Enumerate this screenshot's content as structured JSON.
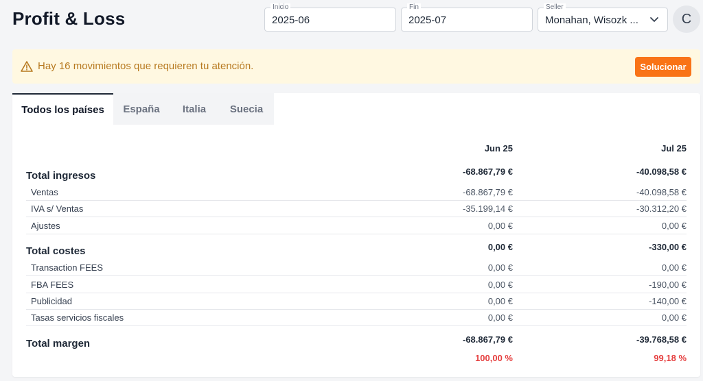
{
  "header": {
    "title": "Profit & Loss",
    "inicio": {
      "label": "Inicio",
      "value": "2025-06"
    },
    "fin": {
      "label": "Fin",
      "value": "2025-07"
    },
    "seller": {
      "label": "Seller",
      "value": "Monahan, Wisozk ..."
    },
    "avatar_initial": "C"
  },
  "alert": {
    "text": "Hay 16 movimientos que requieren tu atención.",
    "button": "Solucionar",
    "colors": {
      "background": "#fff8e1",
      "text": "#b7791f",
      "button": "#f97316"
    }
  },
  "tabs": [
    "Todos los países",
    "España",
    "Italia",
    "Suecia"
  ],
  "table": {
    "columns": [
      "Jun 25",
      "Jul 25"
    ],
    "ingresos": {
      "label": "Total ingresos",
      "values": [
        "-68.867,79 €",
        "-40.098,58 €"
      ],
      "rows": [
        {
          "label": "Ventas",
          "values": [
            "-68.867,79 €",
            "-40.098,58 €"
          ]
        },
        {
          "label": "IVA s/ Ventas",
          "values": [
            "-35.199,14 €",
            "-30.312,20 €"
          ]
        },
        {
          "label": "Ajustes",
          "values": [
            "0,00 €",
            "0,00 €"
          ]
        }
      ]
    },
    "costes": {
      "label": "Total costes",
      "values": [
        "0,00 €",
        "-330,00 €"
      ],
      "rows": [
        {
          "label": "Transaction FEES",
          "values": [
            "0,00 €",
            "0,00 €"
          ]
        },
        {
          "label": "FBA FEES",
          "values": [
            "0,00 €",
            "-190,00 €"
          ]
        },
        {
          "label": "Publicidad",
          "values": [
            "0,00 €",
            "-140,00 €"
          ]
        },
        {
          "label": "Tasas servicios fiscales",
          "values": [
            "0,00 €",
            "0,00 €"
          ]
        }
      ]
    },
    "margen": {
      "label": "Total margen",
      "values": [
        "-68.867,79 €",
        "-39.768,58 €"
      ],
      "percent": [
        "100,00 %",
        "99,18 %"
      ]
    }
  }
}
